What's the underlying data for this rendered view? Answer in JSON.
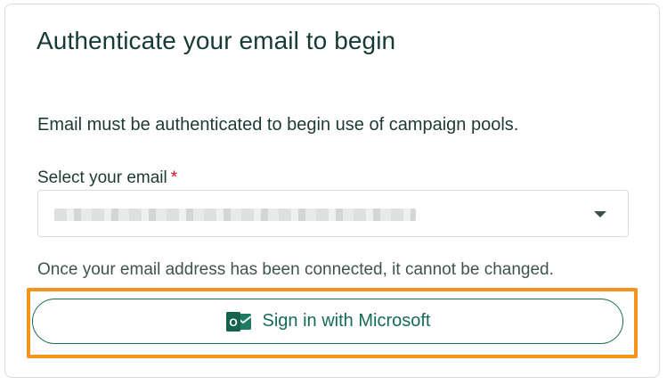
{
  "card": {
    "title": "Authenticate your email to begin",
    "description": "Email must be authenticated to begin use of campaign pools.",
    "email_field": {
      "label": "Select your email",
      "required_marker": "*",
      "selected_value": "",
      "value_obscured": true
    },
    "helper_text": "Once your email address has been connected, it cannot be changed.",
    "signin_button": {
      "label": "Sign in with Microsoft",
      "icon": "outlook-icon"
    }
  },
  "colors": {
    "title": "#163b35",
    "button_border": "#1a6b5a",
    "button_text": "#146b58",
    "highlight": "#f7941d",
    "required": "#c8102e"
  }
}
